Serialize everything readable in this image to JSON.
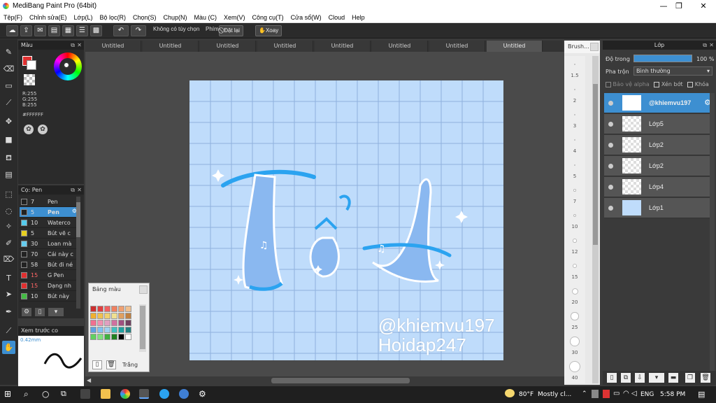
{
  "window": {
    "title": "MediBang Paint Pro (64bit)",
    "min_btn": "—",
    "max_btn": "❐",
    "close_btn": "✕"
  },
  "menu": [
    "Tệp(F)",
    "Chỉnh sửa(E)",
    "Lớp(L)",
    "Bộ lọc(R)",
    "Chọn(S)",
    "Chụp(N)",
    "Màu (C)",
    "Xem(V)",
    "Công cụ(T)",
    "Cửa sổ(W)",
    "Cloud",
    "Help"
  ],
  "toolbar": {
    "no_option_label": "Không có tùy chọn",
    "key_label": "Phím",
    "reset_label": "Đặt lại",
    "rotate_label": "Xoay"
  },
  "color_panel": {
    "title": "Màu",
    "r": "R:255",
    "g": "G:255",
    "b": "B:255",
    "hex": "#FFFFFF"
  },
  "brush_panel": {
    "title": "Cọ: Pen",
    "items": [
      {
        "size": "7",
        "name": "Pen",
        "color": "#222222"
      },
      {
        "size": "5",
        "name": "Pen",
        "color": "#222222",
        "selected": true
      },
      {
        "size": "10",
        "name": "Waterco",
        "color": "#55ccee"
      },
      {
        "size": "5",
        "name": "Bút vẽ c",
        "color": "#e8d020"
      },
      {
        "size": "30",
        "name": "Loan mà",
        "color": "#66ccee"
      },
      {
        "size": "70",
        "name": "Cái này c",
        "color": "#222222"
      },
      {
        "size": "58",
        "name": "Bút đi né",
        "color": "#222222"
      },
      {
        "size": "15",
        "name": "G Pen",
        "color": "#e03030"
      },
      {
        "size": "15",
        "name": "Dạng nh",
        "color": "#e03030"
      },
      {
        "size": "10",
        "name": "Bút này",
        "color": "#44bb44"
      }
    ]
  },
  "preview_panel": {
    "title": "Xem trước co",
    "size": "0.42mm"
  },
  "tabs": [
    "Untitled",
    "Untitled",
    "Untitled",
    "Untitled",
    "Untitled",
    "Untitled",
    "Untitled",
    "Untitled"
  ],
  "canvas": {
    "watermark1": "@khiemvu197",
    "watermark2": "Hoidap247"
  },
  "swatch_panel": {
    "title": "Bảng màu",
    "footer": "Trắng"
  },
  "brush_size_panel": {
    "title": "Brush...",
    "sizes": [
      "1.5",
      "2",
      "3",
      "4",
      "5",
      "7",
      "10",
      "12",
      "15",
      "20",
      "25",
      "30",
      "40"
    ]
  },
  "layer_panel": {
    "title": "Lớp",
    "opacity_label": "Độ trong",
    "opacity_value": "100 %",
    "opacity": 1.0,
    "blend_label": "Pha trộn",
    "blend_value": "Bình thường",
    "protect_alpha": "Bảo vệ alpha",
    "clip": "Xén bớt",
    "lock": "Khóa",
    "layers": [
      "@khiemvu197",
      "Lớp5",
      "Lớp2",
      "Lớp2",
      "Lớp4",
      "Lớp1"
    ]
  },
  "taskbar": {
    "weather_temp": "80°F",
    "weather_text": "Mostly cl...",
    "lang": "ENG",
    "time": "5:58 PM"
  }
}
